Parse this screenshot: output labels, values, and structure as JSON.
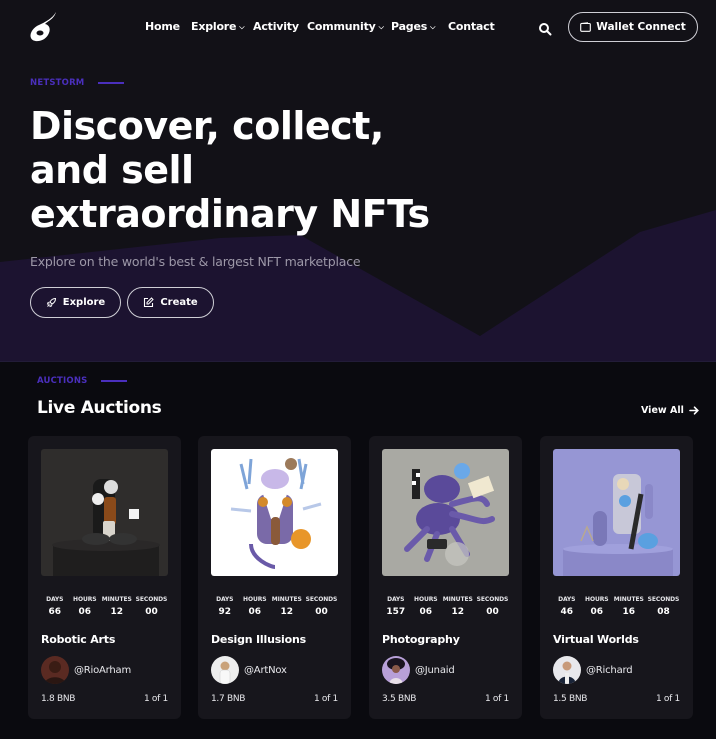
{
  "nav": {
    "items": [
      {
        "label": "Home",
        "has_dropdown": false
      },
      {
        "label": "Explore",
        "has_dropdown": true
      },
      {
        "label": "Activity",
        "has_dropdown": false
      },
      {
        "label": "Community",
        "has_dropdown": true
      },
      {
        "label": "Pages",
        "has_dropdown": true
      },
      {
        "label": "Contact",
        "has_dropdown": false
      }
    ],
    "search_icon": "search-icon",
    "wallet_button": {
      "label": "Wallet Connect",
      "icon": "wallet-icon"
    }
  },
  "hero": {
    "eyebrow": "NETSTORM",
    "title_lines": [
      "Discover, collect,",
      "and sell",
      "extraordinary NFTs"
    ],
    "subtitle": "Explore on the world's best & largest NFT marketplace",
    "buttons": [
      {
        "label": "Explore",
        "icon": "rocket-icon"
      },
      {
        "label": "Create",
        "icon": "edit-icon"
      }
    ]
  },
  "auctions": {
    "eyebrow": "AUCTIONS",
    "title": "Live Auctions",
    "view_all": "View All",
    "countdown_labels": [
      "DAYS",
      "HOURS",
      "MINUTES",
      "SECONDS"
    ],
    "items": [
      {
        "title": "Robotic Arts",
        "owner": "@RioArham",
        "price": "1.8 BNB",
        "edition": "1 of 1",
        "countdown": [
          "66",
          "06",
          "12",
          "00"
        ]
      },
      {
        "title": "Design Illusions",
        "owner": "@ArtNox",
        "price": "1.7 BNB",
        "edition": "1 of 1",
        "countdown": [
          "92",
          "06",
          "12",
          "00"
        ]
      },
      {
        "title": "Photography",
        "owner": "@Junaid",
        "price": "3.5 BNB",
        "edition": "1 of 1",
        "countdown": [
          "157",
          "06",
          "12",
          "00"
        ]
      },
      {
        "title": "Virtual Worlds",
        "owner": "@Richard",
        "price": "1.5 BNB",
        "edition": "1 of 1",
        "countdown": [
          "46",
          "06",
          "16",
          "08"
        ]
      }
    ]
  },
  "colors": {
    "accent": "#4a2fbd",
    "background": "#0a0a0f",
    "hero_background": "#121117",
    "wave": "#1c1330",
    "card": "#17161c"
  }
}
